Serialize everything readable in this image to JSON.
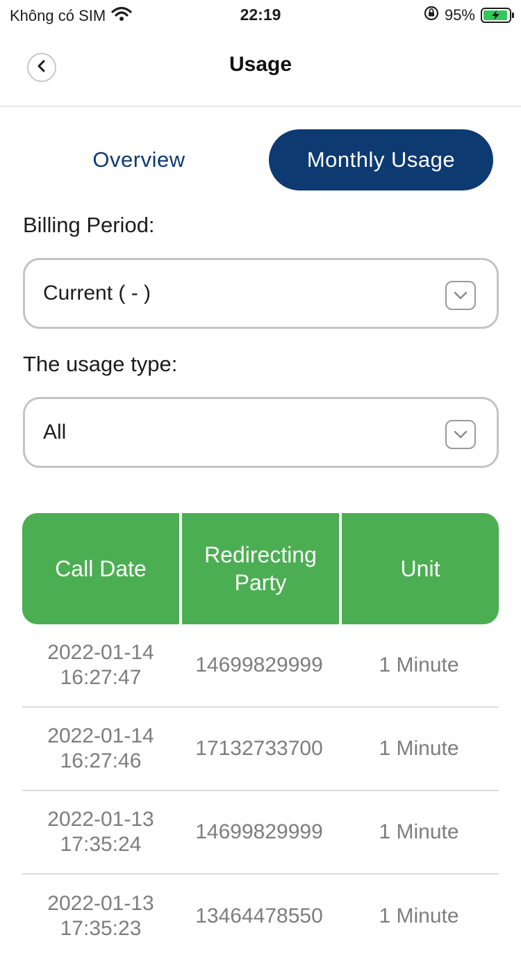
{
  "status_bar": {
    "carrier": "Không có SIM",
    "time": "22:19",
    "battery": "95%",
    "battery_level": 0.95
  },
  "nav": {
    "title": "Usage"
  },
  "tabs": [
    {
      "label": "Overview",
      "active": false
    },
    {
      "label": "Monthly Usage",
      "active": true
    }
  ],
  "billing_period": {
    "label": "Billing Period:",
    "value": "Current ( - )"
  },
  "usage_type": {
    "label": "The usage type:",
    "value": "All"
  },
  "table": {
    "headers": [
      "Call Date",
      "Redirecting Party",
      "Unit"
    ],
    "header_color": "#4cae52",
    "rows": [
      {
        "date": "2022-01-14",
        "time": "16:27:47",
        "party": "14699829999",
        "unit": "1 Minute"
      },
      {
        "date": "2022-01-14",
        "time": "16:27:46",
        "party": "17132733700",
        "unit": "1 Minute"
      },
      {
        "date": "2022-01-13",
        "time": "17:35:24",
        "party": "14699829999",
        "unit": "1 Minute"
      },
      {
        "date": "2022-01-13",
        "time": "17:35:23",
        "party": "13464478550",
        "unit": "1 Minute"
      }
    ]
  },
  "colors": {
    "accent": "#0e3a72",
    "table_header": "#4cae52"
  }
}
